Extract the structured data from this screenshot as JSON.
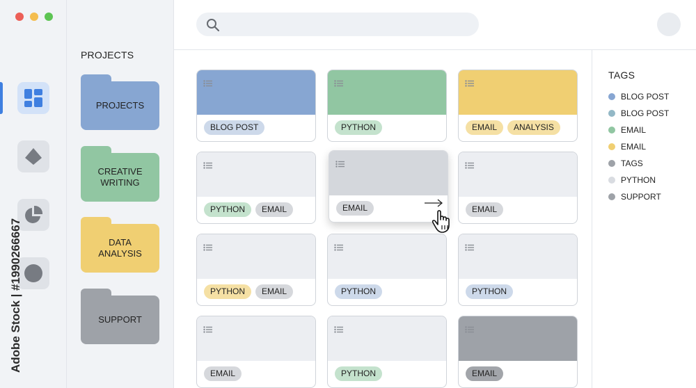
{
  "window_dots": [
    "#ec5f57",
    "#f4bd4f",
    "#5dc453"
  ],
  "rail": {
    "buttons": [
      {
        "icon": "dashboard-icon",
        "active": true
      },
      {
        "icon": "diamond-shape-icon",
        "active": false
      },
      {
        "icon": "pie-chart-icon",
        "active": false
      },
      {
        "icon": "circle-icon",
        "active": false
      }
    ]
  },
  "watermark": "Adobe Stock | #1990266667",
  "folders": {
    "title": "PROJECTS",
    "items": [
      {
        "label": "PROJECTS",
        "color": "#87a6d2"
      },
      {
        "label": "CREATIVE\nWRITING",
        "color": "#91c6a2"
      },
      {
        "label": "DATA\nANALYSIS",
        "color": "#f0cf72"
      },
      {
        "label": "SUPPORT",
        "color": "#9ea2a8"
      }
    ]
  },
  "header": {
    "search_placeholder": "",
    "search_icon": "search-icon",
    "avatar_icon": "avatar"
  },
  "tags": {
    "title": "TAGS",
    "items": [
      {
        "label": "BLOG POST",
        "color": "#87a6d2"
      },
      {
        "label": "BLOG POST",
        "color": "#93b8c6"
      },
      {
        "label": "EMAIL",
        "color": "#91c6a2"
      },
      {
        "label": "EMAIL",
        "color": "#f0cf72"
      },
      {
        "label": "TAGS",
        "color": "#9ea2a8"
      },
      {
        "label": "PYTHON",
        "color": "#d9dce1"
      },
      {
        "label": "SUPPORT",
        "color": "#9ea2a8"
      }
    ]
  },
  "colors": {
    "blue": "#87a6d2",
    "green": "#91c6a2",
    "yellow": "#f0cf72",
    "gray_light": "#eceef2",
    "gray_mid": "#d4d7dc",
    "gray_dark": "#9ea2a8",
    "pill_blue": "#cdd9ea",
    "pill_green": "#c4e2cd",
    "pill_yellow": "#f5e0a4",
    "pill_gray": "#d6d8dc",
    "pill_dark": "#a2a5aa",
    "accent": "#3f7fe0"
  },
  "cards": [
    {
      "top": "blue",
      "pills": [
        {
          "label": "BLOG POST",
          "color": "pill_blue"
        }
      ]
    },
    {
      "top": "green",
      "pills": [
        {
          "label": "PYTHON",
          "color": "pill_green"
        }
      ]
    },
    {
      "top": "yellow",
      "pills": [
        {
          "label": "EMAIL",
          "color": "pill_yellow"
        },
        {
          "label": "ANALYSIS",
          "color": "pill_yellow"
        }
      ]
    },
    {
      "top": "gray_light",
      "pills": [
        {
          "label": "PYTHON",
          "color": "pill_green"
        },
        {
          "label": "EMAIL",
          "color": "pill_gray"
        }
      ]
    },
    {
      "top": "gray_mid",
      "dragging": true,
      "pills": [
        {
          "label": "EMAIL",
          "color": "pill_gray"
        }
      ]
    },
    {
      "top": "gray_light",
      "pills": [
        {
          "label": "EMAIL",
          "color": "pill_gray"
        }
      ]
    },
    {
      "top": "gray_light",
      "pills": [
        {
          "label": "PYTHON",
          "color": "pill_yellow"
        },
        {
          "label": "EMAIL",
          "color": "pill_gray"
        }
      ]
    },
    {
      "top": "gray_light",
      "pills": [
        {
          "label": "PYTHON",
          "color": "pill_blue"
        }
      ]
    },
    {
      "top": "gray_light",
      "pills": [
        {
          "label": "PYTHON",
          "color": "pill_blue"
        }
      ]
    },
    {
      "top": "gray_light",
      "pills": [
        {
          "label": "EMAIL",
          "color": "pill_gray"
        }
      ]
    },
    {
      "top": "gray_light",
      "pills": [
        {
          "label": "PYTHON",
          "color": "pill_green"
        }
      ]
    },
    {
      "top": "gray_dark",
      "pills": [
        {
          "label": "EMAIL",
          "color": "pill_dark"
        }
      ]
    }
  ]
}
